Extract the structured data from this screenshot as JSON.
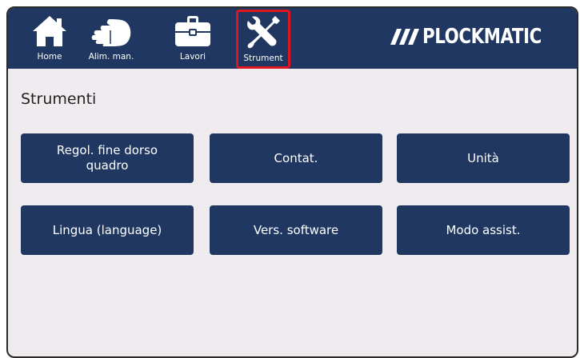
{
  "nav": {
    "items": [
      {
        "label": "Home",
        "icon": "home-icon"
      },
      {
        "label": "Alim. man.",
        "icon": "hand-icon"
      },
      {
        "label": "Lavori",
        "icon": "briefcase-icon"
      },
      {
        "label": "Strument",
        "icon": "tools-icon",
        "active": true
      }
    ],
    "highlight_color": "#e0151f"
  },
  "brand": {
    "logo_text": "PLOCKMATIC",
    "color": "#1f3761"
  },
  "page": {
    "title": "Strumenti"
  },
  "tools": [
    {
      "label": "Regol. fine dorso quadro"
    },
    {
      "label": "Contat."
    },
    {
      "label": "Unità"
    },
    {
      "label": "Lingua (language)"
    },
    {
      "label": "Vers. software"
    },
    {
      "label": "Modo assist."
    }
  ]
}
